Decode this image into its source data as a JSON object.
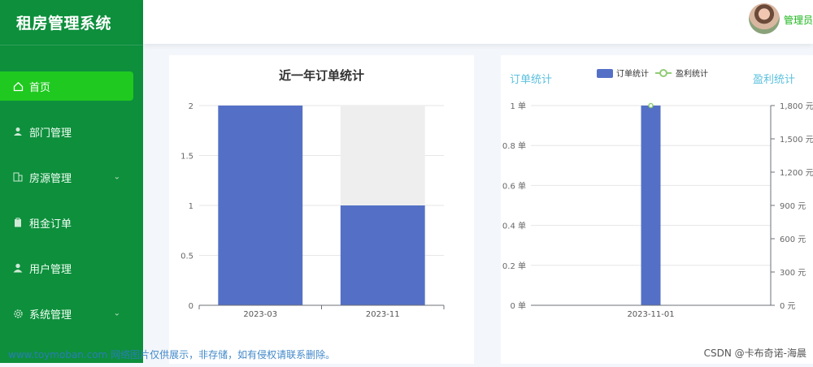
{
  "sidebar": {
    "title": "租房管理系统",
    "items": [
      {
        "label": "首页",
        "icon": "home-icon",
        "active": true
      },
      {
        "label": "部门管理",
        "icon": "user-icon"
      },
      {
        "label": "房源管理",
        "icon": "building-icon",
        "expandable": true
      },
      {
        "label": "租金订单",
        "icon": "clipboard-icon"
      },
      {
        "label": "用户管理",
        "icon": "person-icon"
      },
      {
        "label": "系统管理",
        "icon": "gear-icon",
        "expandable": true
      }
    ]
  },
  "header": {
    "username": "管理员"
  },
  "colors": {
    "sidebar": "#0d8f3c",
    "active": "#1fc91f",
    "bar": "#5470c6",
    "line": "#91cc75",
    "axis_title": "#5bc0de"
  },
  "chart_data": [
    {
      "type": "bar",
      "title": "近一年订单统计",
      "categories": [
        "2023-03",
        "2023-11"
      ],
      "values": [
        2,
        1
      ],
      "background_max": 2,
      "ylim": [
        0,
        2
      ],
      "yticks": [
        "0",
        "0.5",
        "1",
        "1.5",
        "2"
      ],
      "grid": true
    },
    {
      "type": "bar",
      "categories": [
        "2023-11-01"
      ],
      "series": [
        {
          "name": "订单统计",
          "type": "bar",
          "values": [
            1
          ],
          "axis": "left"
        },
        {
          "name": "盈利统计",
          "type": "line",
          "values": [
            1800
          ],
          "axis": "right"
        }
      ],
      "left_axis_title": "订单统计",
      "right_axis_title": "盈利统计",
      "ylim_left": [
        0,
        1
      ],
      "ylim_right": [
        0,
        1800
      ],
      "yticks_left": [
        "0 单",
        "0.2 单",
        "0.4 单",
        "0.6 单",
        "0.8 单",
        "1 单"
      ],
      "yticks_right": [
        "0 元",
        "300 元",
        "600 元",
        "900 元",
        "1,200 元",
        "1,500 元",
        "1,800 元"
      ],
      "legend": "top"
    }
  ],
  "footer": {
    "watermark": "www.toymoban.com 网络图片仅供展示，非存储，如有侵权请联系删除。",
    "credit": "CSDN @卡布奇诺-海晨"
  }
}
